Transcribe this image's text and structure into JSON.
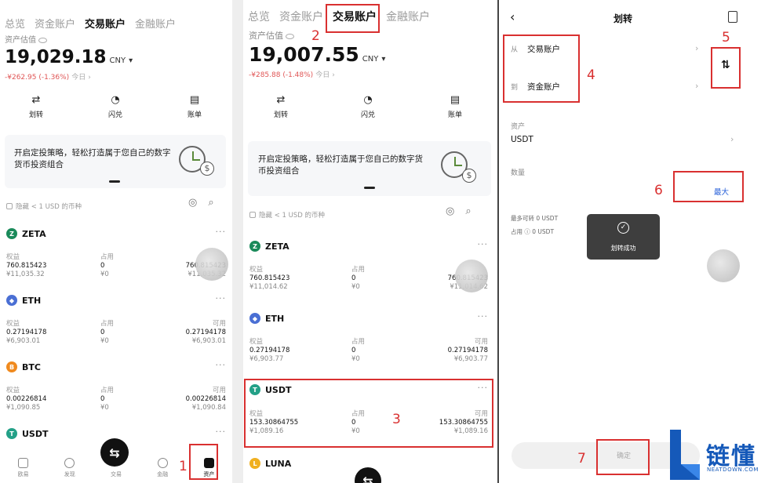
{
  "screen1": {
    "tabs": [
      "总览",
      "资金账户",
      "交易账户",
      "金融账户"
    ],
    "active_tab": "交易账户",
    "estimate_label": "资产估值",
    "balance": "19,029.18",
    "currency": "CNY",
    "change": "-¥262.95 (-1.36%)",
    "today": "今日",
    "actions": [
      "划转",
      "闪兑",
      "账单"
    ],
    "banner_text": "开启定投策略，轻松打造属于您自己的数字货币投资组合",
    "hide_small": "隐藏 < 1 USD 的币种",
    "col_labels": [
      "权益",
      "占用",
      "可用"
    ],
    "assets": [
      {
        "name": "ZETA",
        "icon_color": "#1a8a5a",
        "equity": "760.815423",
        "equity_cny": "¥11,035.32",
        "occupied": "0",
        "occupied_cny": "¥0",
        "available": "760.815423",
        "available_cny": "¥11,035.32"
      },
      {
        "name": "ETH",
        "icon_color": "#4a6fd4",
        "equity": "0.27194178",
        "equity_cny": "¥6,903.01",
        "occupied": "0",
        "occupied_cny": "¥0",
        "available": "0.27194178",
        "available_cny": "¥6,903.01"
      },
      {
        "name": "BTC",
        "icon_color": "#f08a1e",
        "equity": "0.00226814",
        "equity_cny": "¥1,090.85",
        "occupied": "0",
        "occupied_cny": "¥0",
        "available": "0.00226814",
        "available_cny": "¥1,090.84"
      },
      {
        "name": "USDT",
        "icon_color": "#23a087"
      }
    ],
    "bottom_nav": [
      "欧易",
      "发现",
      "交易",
      "金融",
      "资产"
    ],
    "active_nav": "资产"
  },
  "screen2": {
    "tabs": [
      "总览",
      "资金账户",
      "交易账户",
      "金融账户"
    ],
    "active_tab": "交易账户",
    "estimate_label": "资产估值",
    "balance": "19,007.55",
    "currency": "CNY",
    "change": "-¥285.88 (-1.48%)",
    "today": "今日",
    "actions": [
      "划转",
      "闪兑",
      "账单"
    ],
    "banner_text": "开启定投策略，轻松打造属于您自己的数字货币投资组合",
    "hide_small": "隐藏 < 1 USD 的币种",
    "col_labels": [
      "权益",
      "占用",
      "可用"
    ],
    "assets": [
      {
        "name": "ZETA",
        "icon_color": "#1a8a5a",
        "equity": "760.815423",
        "equity_cny": "¥11,014.62",
        "occupied": "0",
        "occupied_cny": "¥0",
        "available": "760.815423",
        "available_cny": "¥11,014.62"
      },
      {
        "name": "ETH",
        "icon_color": "#4a6fd4",
        "equity": "0.27194178",
        "equity_cny": "¥6,903.77",
        "occupied": "0",
        "occupied_cny": "¥0",
        "available": "0.27194178",
        "available_cny": "¥6,903.77"
      },
      {
        "name": "USDT",
        "icon_color": "#23a087",
        "equity": "153.30864755",
        "equity_cny": "¥1,089.16",
        "occupied": "0",
        "occupied_cny": "¥0",
        "available": "153.30864755",
        "available_cny": "¥1,089.16"
      },
      {
        "name": "LUNA",
        "icon_color": "#f0b020"
      }
    ]
  },
  "screen3": {
    "title": "划转",
    "from_label": "从",
    "from_value": "交易账户",
    "to_label": "到",
    "to_value": "资金账户",
    "swap_symbol": "⇅",
    "asset_label": "资产",
    "asset_value": "USDT",
    "amount_label": "数量",
    "max_label": "最大",
    "max_available": "最多可转 0 USDT",
    "occupied": "占用",
    "occupied_value": "0 USDT",
    "toast": "划转成功",
    "confirm": "确定"
  },
  "steps": [
    "1",
    "2",
    "3",
    "4",
    "5",
    "6",
    "7"
  ],
  "logo": {
    "text": "链懂",
    "sub": "NEATDOWN.COM",
    "color": "#1559b9"
  },
  "accent_red": "#d93030"
}
